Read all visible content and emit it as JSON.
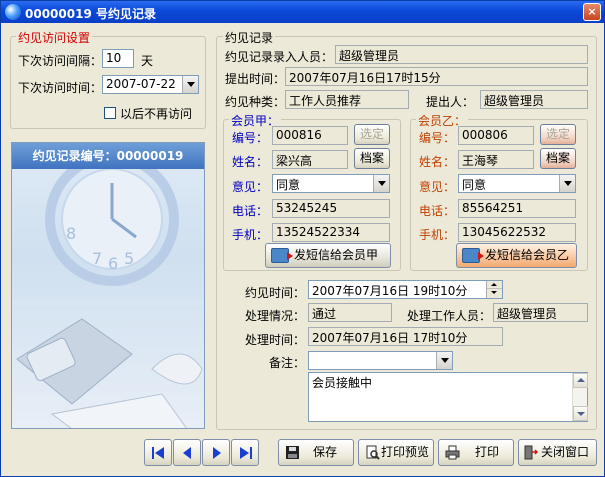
{
  "window": {
    "title": "00000019 号约见记录",
    "close_label": "×"
  },
  "visit_settings": {
    "legend": "约见访问设置",
    "interval_label": "下次访问间隔：",
    "interval_value": "10",
    "interval_unit": "天",
    "next_time_label": "下次访问时间：",
    "next_time_value": "2007-07-22",
    "no_more_visit_label": "以后不再访问"
  },
  "deco_panel": {
    "header": "约见记录编号：00000019"
  },
  "record": {
    "legend": "约见记录",
    "entry_person_label": "约见记录录入人员：",
    "entry_person_value": "超级管理员",
    "submit_time_label": "提出时间：",
    "submit_time_value": "2007年07月16日17时15分",
    "type_label": "约见种类：",
    "type_value": "工作人员推荐",
    "proposer_label": "提出人：",
    "proposer_value": "超级管理员"
  },
  "member_a": {
    "legend": "会员甲：",
    "id_label": "编号：",
    "id_value": "000816",
    "select_button": "选定",
    "name_label": "姓名：",
    "name_value": "梁兴高",
    "archive_button": "档案",
    "opinion_label": "意见：",
    "opinion_value": "同意",
    "phone_label": "电话：",
    "phone_value": "53245245",
    "mobile_label": "手机：",
    "mobile_value": "13524522334",
    "sms_button": "发短信给会员甲"
  },
  "member_b": {
    "legend": "会员乙：",
    "id_label": "编号：",
    "id_value": "000806",
    "select_button": "选定",
    "name_label": "姓名：",
    "name_value": "王海琴",
    "archive_button": "档案",
    "opinion_label": "意见：",
    "opinion_value": "同意",
    "phone_label": "电话：",
    "phone_value": "85564251",
    "mobile_label": "手机：",
    "mobile_value": "13045622532",
    "sms_button": "发短信给会员乙"
  },
  "meeting": {
    "time_label": "约见时间：",
    "time_value": "2007年07月16日  19时10分",
    "status_label": "处理情况：",
    "status_value": "通过",
    "handler_label": "处理工作人员：",
    "handler_value": "超级管理员",
    "handle_time_label": "处理时间：",
    "handle_time_value": "2007年07月16日  17时10分",
    "note_label": "备注：",
    "note_select_value": "",
    "note_text": "会员接触中"
  },
  "toolbar": {
    "save": "保存",
    "print_preview": "打印预览",
    "print": "打印",
    "close_window": "关闭窗口"
  }
}
